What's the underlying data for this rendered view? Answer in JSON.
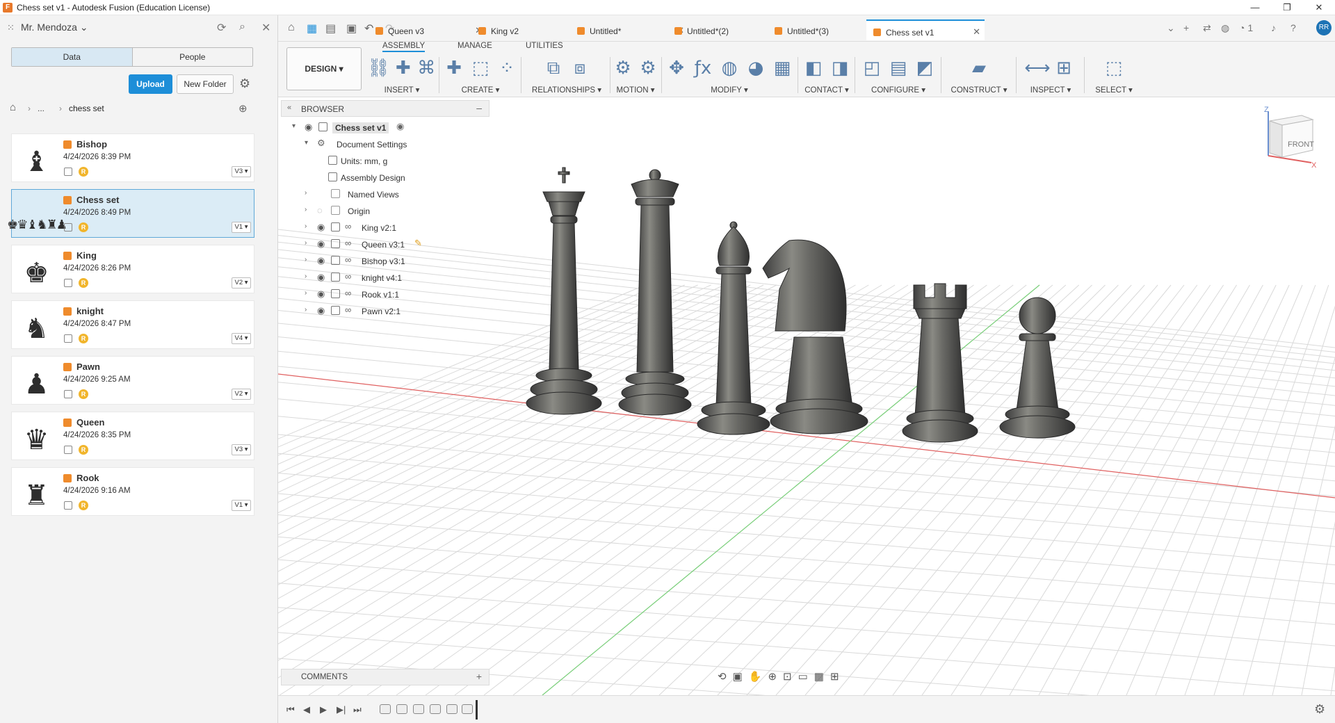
{
  "window": {
    "title": "Chess set v1 - Autodesk Fusion (Education License)",
    "controls": [
      "—",
      "❐",
      "✕"
    ]
  },
  "data_panel": {
    "user": "Mr. Mendoza",
    "tabs": [
      {
        "label": "Data",
        "active": true
      },
      {
        "label": "People",
        "active": false
      }
    ],
    "upload_label": "Upload",
    "new_folder_label": "New Folder",
    "breadcrumb": {
      "dots": "...",
      "current": "chess set"
    },
    "files": [
      {
        "name": "Bishop",
        "date": "4/24/2026 8:39 PM",
        "version": "V3 ▾",
        "piece": "♝",
        "selected": false
      },
      {
        "name": "Chess set",
        "date": "4/24/2026 8:49 PM",
        "version": "V1 ▾",
        "piece": "♚♛♝♞♜♟",
        "selected": true
      },
      {
        "name": "King",
        "date": "4/24/2026 8:26 PM",
        "version": "V2 ▾",
        "piece": "♚",
        "selected": false
      },
      {
        "name": "knight",
        "date": "4/24/2026 8:47 PM",
        "version": "V4 ▾",
        "piece": "♞",
        "selected": false
      },
      {
        "name": "Pawn",
        "date": "4/24/2026 9:25 AM",
        "version": "V2 ▾",
        "piece": "♟",
        "selected": false
      },
      {
        "name": "Queen",
        "date": "4/24/2026 8:35 PM",
        "version": "V3 ▾",
        "piece": "♛",
        "selected": false
      },
      {
        "name": "Rook",
        "date": "4/24/2026 9:16 AM",
        "version": "V1 ▾",
        "piece": "♜",
        "selected": false
      }
    ],
    "badge_letter": "R"
  },
  "doc_tabs": [
    {
      "label": "Queen v3",
      "active": false
    },
    {
      "label": "King v2",
      "active": false
    },
    {
      "label": "Untitled*",
      "active": false
    },
    {
      "label": "Untitled*(2)",
      "active": false
    },
    {
      "label": "Untitled*(3)",
      "active": false
    },
    {
      "label": "Chess set v1",
      "active": true
    }
  ],
  "header_right": {
    "jobs_count": "1",
    "avatar": "RR"
  },
  "toolbar": {
    "workspace": "DESIGN ▾",
    "tabs": [
      "ASSEMBLY",
      "MANAGE",
      "UTILITIES"
    ],
    "groups": [
      {
        "label": "INSERT ▾",
        "icons": [
          "⛓",
          "✚",
          "⌘"
        ]
      },
      {
        "label": "CREATE ▾",
        "icons": [
          "✚",
          "⬚",
          "⁘"
        ]
      },
      {
        "label": "RELATIONSHIPS ▾",
        "icons": [
          "⧉",
          "⧈"
        ]
      },
      {
        "label": "MOTION ▾",
        "icons": [
          "⚙",
          "⚙"
        ]
      },
      {
        "label": "MODIFY ▾",
        "icons": [
          "✥",
          "ƒx",
          "◍",
          "◕",
          "▦"
        ]
      },
      {
        "label": "CONTACT ▾",
        "icons": [
          "◧",
          "◨"
        ]
      },
      {
        "label": "CONFIGURE ▾",
        "icons": [
          "◰",
          "▤",
          "◩"
        ]
      },
      {
        "label": "CONSTRUCT ▾",
        "icons": [
          "▰"
        ]
      },
      {
        "label": "INSPECT ▾",
        "icons": [
          "⟷",
          "⊞"
        ]
      },
      {
        "label": "SELECT ▾",
        "icons": [
          "⬚"
        ]
      }
    ]
  },
  "browser": {
    "title": "BROWSER",
    "items": [
      {
        "label": "Chess set v1",
        "level": 0,
        "type": "root"
      },
      {
        "label": "Document Settings",
        "level": 1,
        "type": "settings"
      },
      {
        "label": "Units: mm, g",
        "level": 2,
        "type": "doc"
      },
      {
        "label": "Assembly Design",
        "level": 2,
        "type": "doc"
      },
      {
        "label": "Named Views",
        "level": 1,
        "type": "folder"
      },
      {
        "label": "Origin",
        "level": 1,
        "type": "folder"
      },
      {
        "label": "King v2:1",
        "level": 1,
        "type": "component"
      },
      {
        "label": "Queen v3:1",
        "level": 1,
        "type": "component"
      },
      {
        "label": "Bishop v3:1",
        "level": 1,
        "type": "component"
      },
      {
        "label": "knight v4:1",
        "level": 1,
        "type": "component"
      },
      {
        "label": "Rook v1:1",
        "level": 1,
        "type": "component"
      },
      {
        "label": "Pawn v2:1",
        "level": 1,
        "type": "component"
      }
    ]
  },
  "viewcube": {
    "face": "FRONT",
    "axis_z": "Z",
    "axis_x": "X"
  },
  "comments_label": "COMMENTS",
  "colors": {
    "accent": "#1d8ed8",
    "piece": "#5e5e5e",
    "grid": "#d8d8d8",
    "x_axis": "#e06060",
    "y_axis": "#7ad07a"
  }
}
